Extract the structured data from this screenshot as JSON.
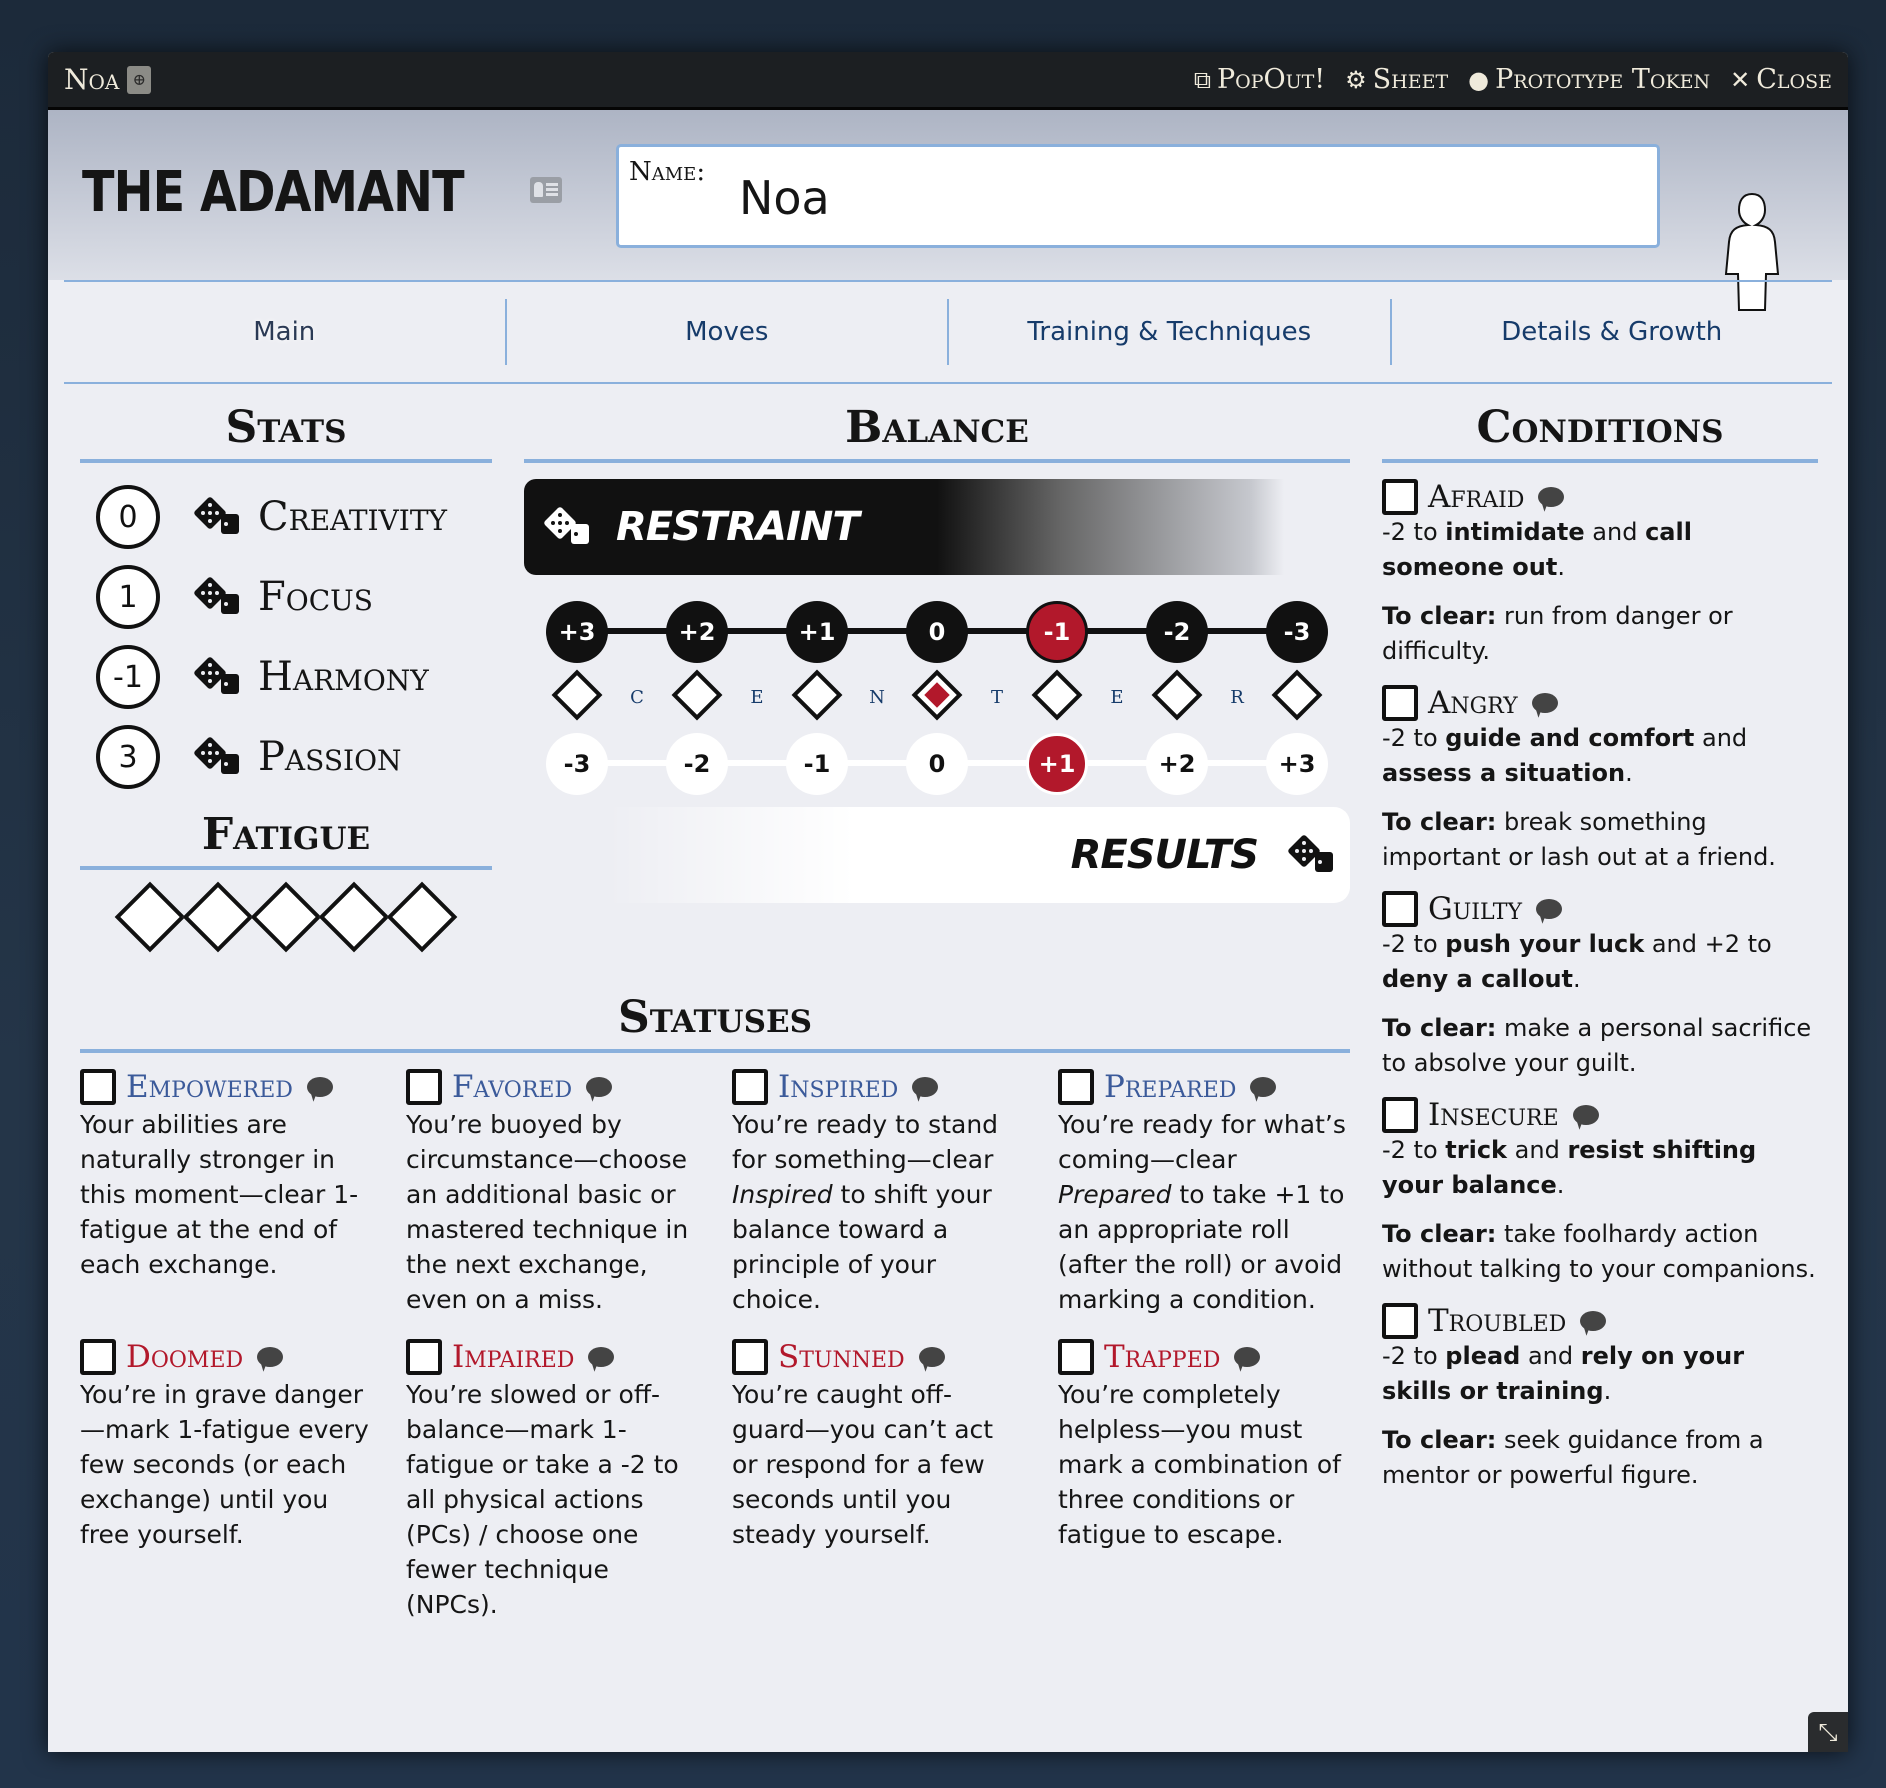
{
  "window": {
    "title": "Noa",
    "buttons": {
      "popout": "PopOut!",
      "sheet": "Sheet",
      "prototype_token": "Prototype Token",
      "close": "Close"
    }
  },
  "header": {
    "playbook": "THE ADAMANT",
    "name_label": "Name:",
    "name_value": "Noa"
  },
  "tabs": [
    {
      "label": "Main",
      "active": true
    },
    {
      "label": "Moves",
      "active": false
    },
    {
      "label": "Training & Techniques",
      "active": false
    },
    {
      "label": "Details & Growth",
      "active": false
    }
  ],
  "stats": {
    "title": "Stats",
    "items": [
      {
        "name": "Creativity",
        "value": "0"
      },
      {
        "name": "Focus",
        "value": "1"
      },
      {
        "name": "Harmony",
        "value": "-1"
      },
      {
        "name": "Passion",
        "value": "3"
      }
    ]
  },
  "fatigue": {
    "title": "Fatigue",
    "max": 5,
    "marked": 0
  },
  "balance": {
    "title": "Balance",
    "principle_top": "RESTRAINT",
    "principle_bottom": "RESULTS",
    "top_values": [
      "+3",
      "+2",
      "+1",
      "0",
      "-1",
      "-2",
      "-3"
    ],
    "bottom_values": [
      "-3",
      "-2",
      "-1",
      "0",
      "+1",
      "+2",
      "+3"
    ],
    "selected_index": 4,
    "center_letters": [
      "C",
      "E",
      "N",
      "T",
      "E",
      "R"
    ],
    "center_marked_index": 3,
    "colors": {
      "selected": "#b2182b",
      "center": "#b2182b"
    }
  },
  "statuses": {
    "title": "Statuses",
    "items": [
      {
        "name": "Empowered",
        "type": "pos",
        "checked": false,
        "desc": "Your abilities are naturally stronger in this moment—clear 1-fatigue at the end of each exchange."
      },
      {
        "name": "Favored",
        "type": "pos",
        "checked": false,
        "desc": "You’re buoyed by circumstance—choose an additional basic or mastered technique in the next exchange, even on a miss."
      },
      {
        "name": "Inspired",
        "type": "pos",
        "checked": false,
        "desc_pre": "You’re ready to stand for something—clear ",
        "desc_em": "Inspired",
        "desc_post": " to shift your balance toward a principle of your choice."
      },
      {
        "name": "Prepared",
        "type": "pos",
        "checked": false,
        "desc_pre": "You’re ready for what’s coming—clear ",
        "desc_em": "Prepared",
        "desc_post": " to take +1 to an appropriate roll (after the roll) or avoid marking a condition."
      },
      {
        "name": "Doomed",
        "type": "neg",
        "checked": false,
        "desc": "You’re in grave danger—mark 1-fatigue every few seconds (or each exchange) until you free yourself."
      },
      {
        "name": "Impaired",
        "type": "neg",
        "checked": false,
        "desc": "You’re slowed or off-balance—mark 1-fatigue or take a -2 to all physical actions (PCs) / choose one fewer technique (NPCs)."
      },
      {
        "name": "Stunned",
        "type": "neg",
        "checked": false,
        "desc": "You’re caught off-guard—you can’t act or respond for a few seconds until you steady yourself."
      },
      {
        "name": "Trapped",
        "type": "neg",
        "checked": false,
        "desc": "You’re completely helpless—you must mark a combination of three conditions or fatigue to escape."
      }
    ]
  },
  "conditions": {
    "title": "Conditions",
    "clear_label": "To clear:",
    "items": [
      {
        "name": "Afraid",
        "checked": false,
        "effect": [
          [
            "-2 to ",
            false
          ],
          [
            "intimidate",
            true
          ],
          [
            " and ",
            false
          ],
          [
            "call someone out",
            true
          ],
          [
            ".",
            false
          ]
        ],
        "clear": " run from danger or difficulty."
      },
      {
        "name": "Angry",
        "checked": false,
        "effect": [
          [
            "-2 to ",
            false
          ],
          [
            "guide and comfort",
            true
          ],
          [
            " and ",
            false
          ],
          [
            "assess a situation",
            true
          ],
          [
            ".",
            false
          ]
        ],
        "clear": " break something important or lash out at a friend."
      },
      {
        "name": "Guilty",
        "checked": false,
        "effect": [
          [
            "-2 to ",
            false
          ],
          [
            "push your luck",
            true
          ],
          [
            " and +2 to ",
            false
          ],
          [
            "deny a callout",
            true
          ],
          [
            ".",
            false
          ]
        ],
        "clear": " make a personal sacrifice to absolve your guilt."
      },
      {
        "name": "Insecure",
        "checked": false,
        "effect": [
          [
            "-2 to ",
            false
          ],
          [
            "trick",
            true
          ],
          [
            " and ",
            false
          ],
          [
            "resist shifting your balance",
            true
          ],
          [
            ".",
            false
          ]
        ],
        "clear": " take foolhardy action without talking to your companions."
      },
      {
        "name": "Troubled",
        "checked": false,
        "effect": [
          [
            "-2 to ",
            false
          ],
          [
            "plead",
            true
          ],
          [
            " and ",
            false
          ],
          [
            "rely on your skills or training",
            true
          ],
          [
            ".",
            false
          ]
        ],
        "clear": " seek guidance from a mentor or powerful figure."
      }
    ]
  }
}
